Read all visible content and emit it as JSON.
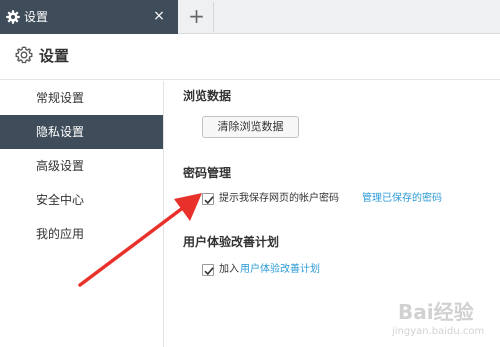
{
  "tab": {
    "title": "设置",
    "close_glyph": "×",
    "new_tab_glyph": "+"
  },
  "header": {
    "title": "设置"
  },
  "sidebar": {
    "items": [
      {
        "label": "常规设置",
        "active": false
      },
      {
        "label": "隐私设置",
        "active": true
      },
      {
        "label": "高级设置",
        "active": false
      },
      {
        "label": "安全中心",
        "active": false
      },
      {
        "label": "我的应用",
        "active": false
      }
    ]
  },
  "main": {
    "browse_data": {
      "title": "浏览数据",
      "clear_button": "清除浏览数据"
    },
    "password": {
      "title": "密码管理",
      "checkbox_label": "提示我保存网页的帐户密码",
      "checked": true,
      "manage_link": "管理已保存的密码"
    },
    "improvement": {
      "title": "用户体验改善计划",
      "checkbox_prefix": "加入",
      "checkbox_link": "用户体验改善计划",
      "checked": true
    }
  },
  "watermark": {
    "text": "Bai经验",
    "sub": "jingyan.baidu.com"
  },
  "colors": {
    "active_bg": "#3f4c5a",
    "link": "#2e9bd6",
    "arrow": "#e8312a"
  },
  "icons": {
    "tab": "gear-icon",
    "header": "gear-icon",
    "checkbox": "checkmark-icon"
  }
}
